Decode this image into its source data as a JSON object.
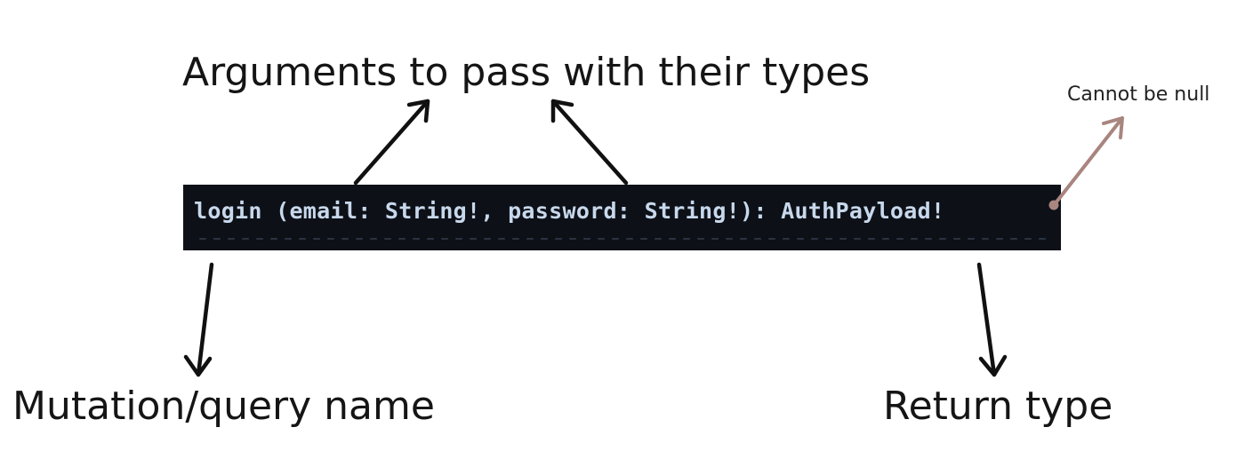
{
  "labels": {
    "arguments": "Arguments to pass with their types",
    "non_null": "Cannot be null",
    "name": "Mutation/query name",
    "return_type": "Return type"
  },
  "code": {
    "signature": "login (email: String!, password: String!): AuthPayload!"
  },
  "colors": {
    "code_background": "#0d1117",
    "code_text": "#c8d8ec",
    "arrow": "#111111",
    "non_null_arrow": "#a98580"
  }
}
